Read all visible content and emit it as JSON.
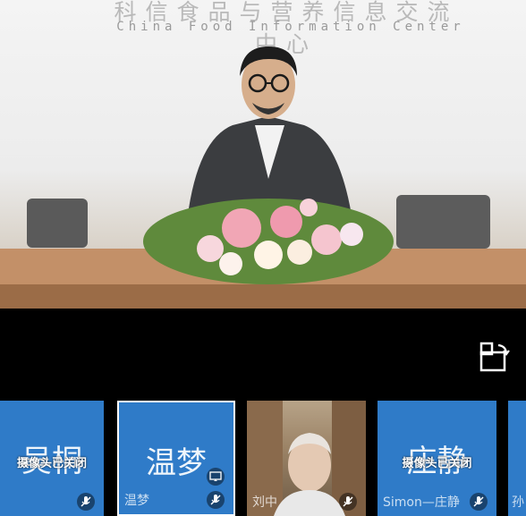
{
  "main_video": {
    "wall_sign_cn": "科信食品与营养信息交流中心",
    "wall_sign_en": "China Food Information Center"
  },
  "participants": [
    {
      "big_name": "吴桐",
      "camera_status": "摄像头已关闭",
      "name": "",
      "mic_icon": "mic-muted-icon",
      "camera_off": true
    },
    {
      "big_name": "温梦",
      "camera_status": "",
      "name": "温梦",
      "mic_icon": "mic-muted-icon",
      "screen_icon": "screen-share-icon",
      "camera_off": false,
      "selected": true
    },
    {
      "big_name": "",
      "camera_status": "",
      "name": "刘中",
      "mic_icon": "mic-muted-icon",
      "camera_off": false,
      "video": true
    },
    {
      "big_name": "庄静",
      "camera_status": "摄像头已关闭",
      "name": "Simon—庄静",
      "mic_icon": "mic-muted-icon",
      "camera_off": true
    },
    {
      "big_name": "",
      "camera_status": "",
      "name": "孙",
      "camera_off": false
    }
  ],
  "colors": {
    "tile_blue": "#2f7bc8",
    "background": "#000000"
  }
}
